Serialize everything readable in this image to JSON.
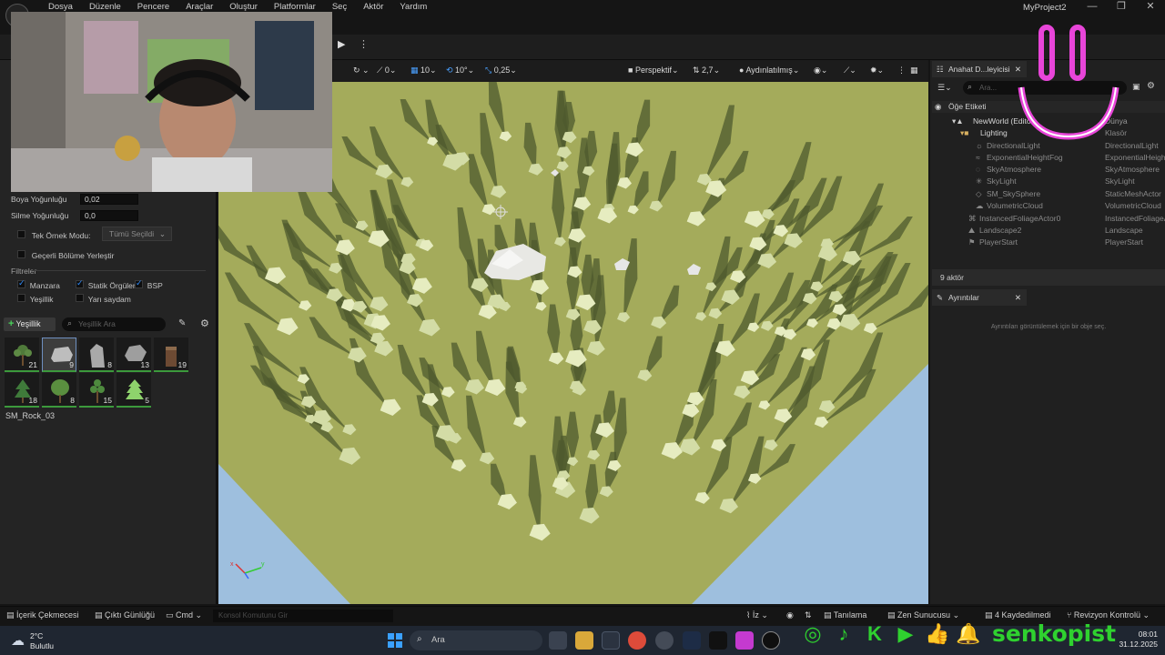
{
  "menu": {
    "items": [
      "Dosya",
      "Düzenle",
      "Pencere",
      "Araçlar",
      "Oluştur",
      "Platformlar",
      "Seç",
      "Aktör",
      "Yardım"
    ],
    "project_title": "MyProject2",
    "logo": "unreal-logo"
  },
  "foliage_settings": {
    "paint_density_label": "Boya Yoğunluğu",
    "paint_density_value": "0,02",
    "erase_density_label": "Silme Yoğunluğu",
    "erase_density_value": "0,0",
    "single_instance_label": "Tek Örnek Modu:",
    "single_instance_value": "Tümü Seçildi",
    "place_in_level_label": "Geçerli Bölüme Yerleştir",
    "filters_label": "Filtreler",
    "filters": [
      {
        "label": "Manzara",
        "checked": true
      },
      {
        "label": "Statik Örgüler",
        "checked": true
      },
      {
        "label": "BSP",
        "checked": true
      },
      {
        "label": "Yeşillik",
        "checked": false
      },
      {
        "label": "Yarı saydam",
        "checked": false
      }
    ]
  },
  "foliage_palette": {
    "add_label": "Yeşillik",
    "search_placeholder": "Yeşillik Ara",
    "items": [
      {
        "type": "bush-icon",
        "count": "21"
      },
      {
        "type": "rock-flat-icon",
        "count": "9",
        "selected": true
      },
      {
        "type": "rock-tall-icon",
        "count": "8"
      },
      {
        "type": "rock-round-icon",
        "count": "13"
      },
      {
        "type": "stump-icon",
        "count": "19"
      },
      {
        "type": "pine-icon",
        "count": "18"
      },
      {
        "type": "tree-round-icon",
        "count": "8"
      },
      {
        "type": "tree-thin-icon",
        "count": "15"
      },
      {
        "type": "conifer-icon",
        "count": "5"
      }
    ],
    "selected_name": "SM_Rock_03"
  },
  "viewport_toolbar": {
    "snap_rotation": "0",
    "grid_size": "10",
    "rotation_snap": "10°",
    "scale_snap": "0,25",
    "view_mode": "Perspektif",
    "camera_speed": "2,7",
    "lighting_mode": "Aydınlatılmış"
  },
  "outliner": {
    "tab_label": "Anahat D...leyicisi",
    "search_placeholder": "Ara...",
    "column_label": "Öğe Etiketi",
    "rows": [
      {
        "name": "NewWorld (Editor)",
        "type": "Dünya",
        "indent": 1
      },
      {
        "name": "Lighting",
        "type": "Klasör",
        "indent": 2
      },
      {
        "name": "DirectionalLight",
        "type": "DirectionalLight",
        "indent": 3
      },
      {
        "name": "ExponentialHeightFog",
        "type": "ExponentialHeightFog",
        "indent": 3
      },
      {
        "name": "SkyAtmosphere",
        "type": "SkyAtmosphere",
        "indent": 3
      },
      {
        "name": "SkyLight",
        "type": "SkyLight",
        "indent": 3
      },
      {
        "name": "SM_SkySphere",
        "type": "StaticMeshActor",
        "indent": 3
      },
      {
        "name": "VolumetricCloud",
        "type": "VolumetricCloud",
        "indent": 3
      },
      {
        "name": "InstancedFoliageActor0",
        "type": "InstancedFoliageActor",
        "indent": 2
      },
      {
        "name": "Landscape2",
        "type": "Landscape",
        "indent": 2
      },
      {
        "name": "PlayerStart",
        "type": "PlayerStart",
        "indent": 2
      }
    ],
    "actor_count": "9 aktör"
  },
  "details": {
    "tab_label": "Ayrıntılar",
    "empty_text": "Ayrıntıları görüntülemek için bir obje seç."
  },
  "statusbar": {
    "content_drawer": "İçerik Çekmecesi",
    "output_log": "Çıktı Günlüğü",
    "cmd": "Cmd",
    "cmd_placeholder": "Konsol Komutunu Gir",
    "derived_data": "İz",
    "trace": "Tanılama",
    "zen": "Zen Sunucusu",
    "unsaved": "4 Kaydedilmedi",
    "revision": "Revizyon Kontrolü"
  },
  "taskbar": {
    "temperature": "2°C",
    "weather": "Bulutlu",
    "search_placeholder": "Ara",
    "time": "08:01",
    "date": "31.12.2025"
  },
  "overlay": {
    "handle": "senkopist"
  }
}
